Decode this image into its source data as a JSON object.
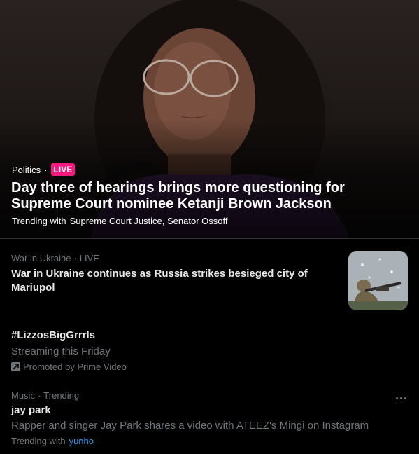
{
  "hero": {
    "category": "Politics",
    "separator": "·",
    "live_label": "LIVE",
    "headline": "Day three of hearings brings more questioning for Supreme Court nominee Ketanji Brown Jackson",
    "trending_prefix": "Trending with",
    "trending_topics": "Supreme Court Justice, Senator Ossoff"
  },
  "news": {
    "category": "War in Ukraine",
    "separator": "·",
    "status": "LIVE",
    "headline": "War in Ukraine continues as Russia strikes besieged city of Mariupol"
  },
  "promoted": {
    "hashtag": "#LizzosBigGrrrls",
    "subtitle": "Streaming this Friday",
    "promoted_by": "Promoted by Prime Video"
  },
  "trend": {
    "category": "Music",
    "separator": "·",
    "status": "Trending",
    "title": "jay park",
    "description": "Rapper and singer Jay Park shares a video with ATEEZ's Mingi on Instagram",
    "trending_prefix": "Trending with",
    "trending_link": "yunho"
  },
  "colors": {
    "background": "#000000",
    "text_primary": "#e7e9ea",
    "text_secondary": "#71767b",
    "live_badge": "#f91880",
    "link": "#1d9bf0",
    "divider": "#2f3336"
  },
  "icons": {
    "promoted": "promoted-arrow-icon",
    "more": "more-dots-icon"
  }
}
